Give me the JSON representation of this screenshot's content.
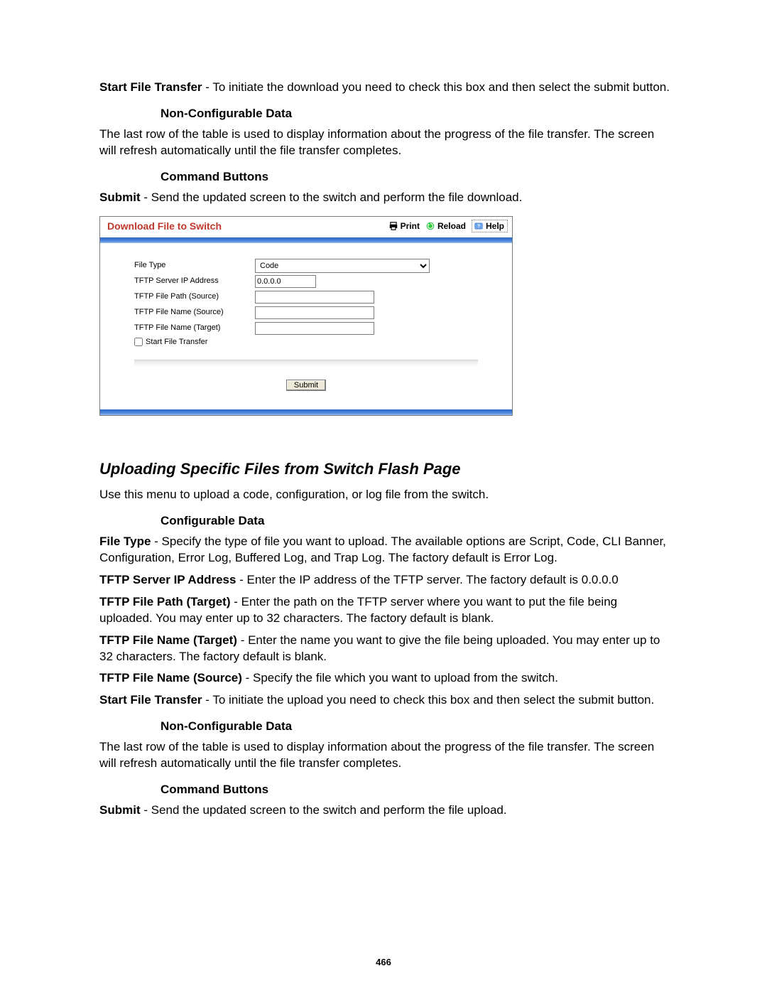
{
  "top": {
    "start_file_transfer_label": "Start File Transfer",
    "start_file_transfer_text": " - To initiate the download you need to check this box and then select the submit button.",
    "non_config_heading": "Non-Configurable Data",
    "non_config_text": "The last row of the table is used to display information about the progress of the file transfer. The screen will refresh automatically until the file transfer completes.",
    "command_buttons_heading": "Command Buttons",
    "submit_label": "Submit",
    "submit_text": " - Send the updated screen to the switch and perform the file download."
  },
  "screenshot": {
    "title": "Download File to Switch",
    "tools": {
      "print": "Print",
      "reload": "Reload",
      "help": "Help"
    },
    "form": {
      "file_type_label": "File Type",
      "file_type_value": "Code",
      "ip_label": "TFTP Server IP Address",
      "ip_value": "0.0.0.0",
      "path_src_label": "TFTP File Path (Source)",
      "path_src_value": "",
      "name_src_label": "TFTP File Name (Source)",
      "name_src_value": "",
      "name_tgt_label": "TFTP File Name (Target)",
      "name_tgt_value": "",
      "start_checkbox_label": "Start File Transfer",
      "submit_button": "Submit"
    }
  },
  "upload_section": {
    "title": "Uploading Specific Files from Switch Flash Page",
    "intro": "Use this menu to upload a code, configuration, or log file from the switch.",
    "config_heading": "Configurable Data",
    "file_type_label": "File Type",
    "file_type_text": " - Specify the type of file you want to upload. The available options are Script, Code, CLI Banner, Configuration, Error Log, Buffered Log, and Trap Log. The factory default is Error Log.",
    "ip_label": "TFTP Server IP Address",
    "ip_text": " - Enter the IP address of the TFTP server. The factory default is 0.0.0.0",
    "path_tgt_label": "TFTP File Path (Target)",
    "path_tgt_text": " - Enter the path on the TFTP server where you want to put the file being uploaded. You may enter up to 32 characters. The factory default is blank.",
    "name_tgt_label": "TFTP File Name (Target)",
    "name_tgt_text": " - Enter the name you want to give the file being uploaded. You may enter up to 32 characters. The factory default is blank.",
    "name_src_label": "TFTP File Name (Source)",
    "name_src_text": " - Specify the file which you want to upload from the switch.",
    "sft_label": "Start File Transfer",
    "sft_text": " - To initiate the upload you need to check this box and then select the submit button.",
    "non_config_heading": "Non-Configurable Data",
    "non_config_text": "The last row of the table is used to display information about the progress of the file transfer. The screen will refresh automatically until the file transfer completes.",
    "command_buttons_heading": "Command Buttons",
    "submit_label": "Submit",
    "submit_text": " - Send the updated screen to the switch and perform the file upload."
  },
  "page_number": "466"
}
